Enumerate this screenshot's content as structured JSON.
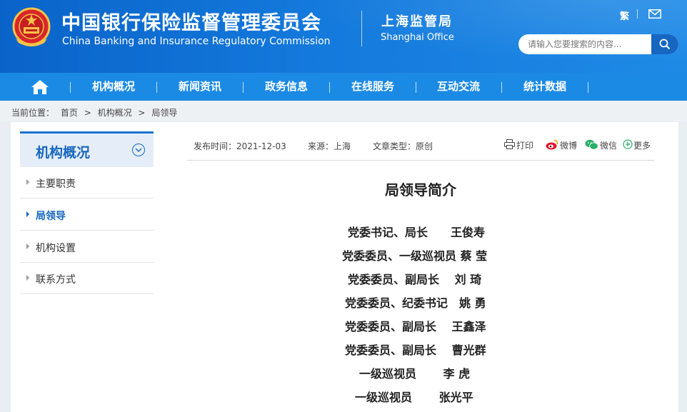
{
  "header": {
    "title_cn": "中国银行保险监督管理委员会",
    "title_en": "China Banking and Insurance Regulatory Commission",
    "office_cn": "上海监管局",
    "office_en": "Shanghai Office",
    "traditional": "繁",
    "mail_icon": "mail-icon",
    "emblem_icon": "national-emblem-icon",
    "search_placeholder": "请输入您要搜索的内容...",
    "search_icon": "search-icon"
  },
  "nav": {
    "home_icon": "home-icon",
    "items": [
      "机构概况",
      "新闻资讯",
      "政务信息",
      "在线服务",
      "互动交流",
      "统计数据"
    ]
  },
  "breadcrumb": {
    "prefix": "当前位置：",
    "items": [
      "首页",
      "机构概况",
      "局领导"
    ],
    "separator": ">"
  },
  "sidebar": {
    "title": "机构概况",
    "items": [
      {
        "label": "主要职责",
        "active": false
      },
      {
        "label": "局领导",
        "active": true
      },
      {
        "label": "机构设置",
        "active": false
      },
      {
        "label": "联系方式",
        "active": false
      }
    ]
  },
  "meta": {
    "publish_time": "发布时间：2021-12-03",
    "source": "来源：上海",
    "type": "文章类型：原创"
  },
  "tools": {
    "print": "打印",
    "weibo": "微博",
    "wechat": "微信",
    "more": "更多"
  },
  "article": {
    "title": "局领导简介",
    "leaders": [
      "党委书记、局长　　王俊寿",
      "党委委员、一级巡视员 蔡 莹",
      "党委委员、副局长　 刘 琦",
      "党委委员、纪委书记　姚 勇",
      "党委委员、副局长　 王鑫泽",
      "党委委员、副局长　 曹光群",
      "一级巡视员　　 李 虎",
      "一级巡视员　　 张光平"
    ]
  },
  "colors": {
    "header_blue": "#0a63c9",
    "nav_blue": "#1b8ae5",
    "accent_blue": "#1766c0"
  }
}
